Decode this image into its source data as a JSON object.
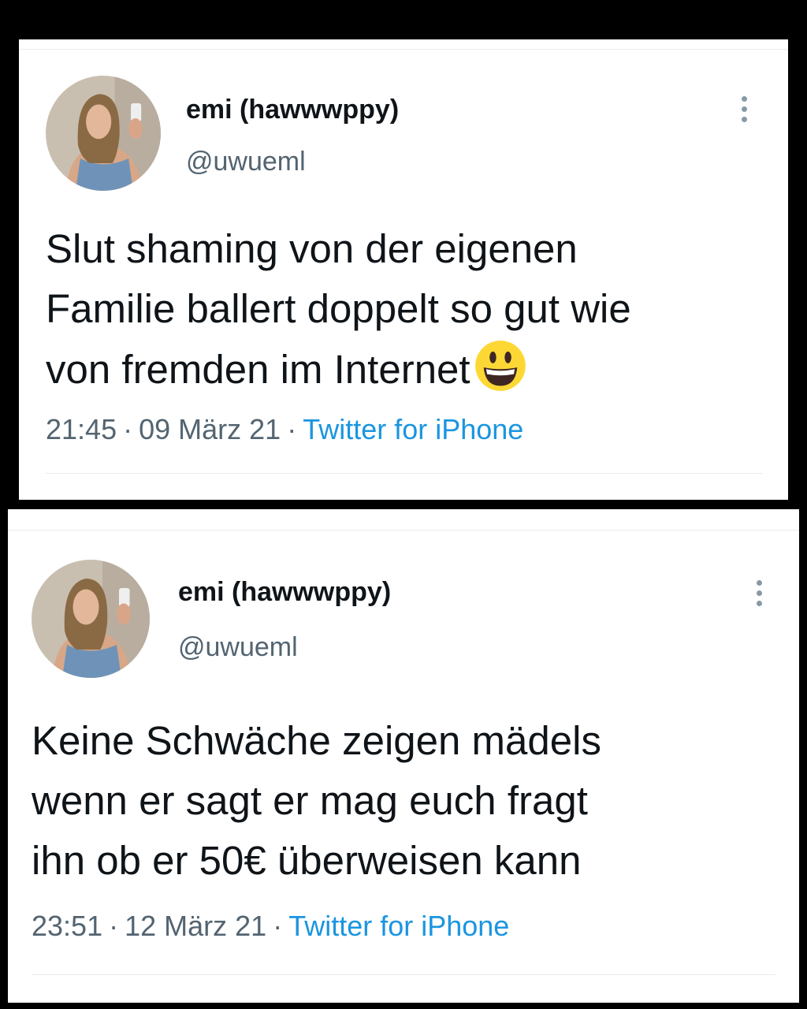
{
  "tweets": [
    {
      "display_name": "emi (hawwwppy)",
      "handle": "@uwueml",
      "text": "Slut shaming von der eigenen\nFamilie ballert doppelt so gut wie\nvon fremden im Internet",
      "emoji": "grinning-face-emoji",
      "time": "21:45",
      "date": "09 März 21",
      "separator": "·",
      "source": "Twitter for iPhone"
    },
    {
      "display_name": "emi (hawwwppy)",
      "handle": "@uwueml",
      "text": "Keine Schwäche zeigen mädels\nwenn er sagt er mag euch fragt\nihn ob er 50€ überweisen kann",
      "time": "23:51",
      "date": "12 März 21",
      "separator": "·",
      "source": "Twitter for iPhone"
    }
  ],
  "icons": {
    "more": "more-vertical-icon"
  },
  "colors": {
    "text": "#0f1419",
    "secondary": "#536471",
    "link": "#1b95e0",
    "divider": "#e6ecf0",
    "background": "#000000"
  }
}
